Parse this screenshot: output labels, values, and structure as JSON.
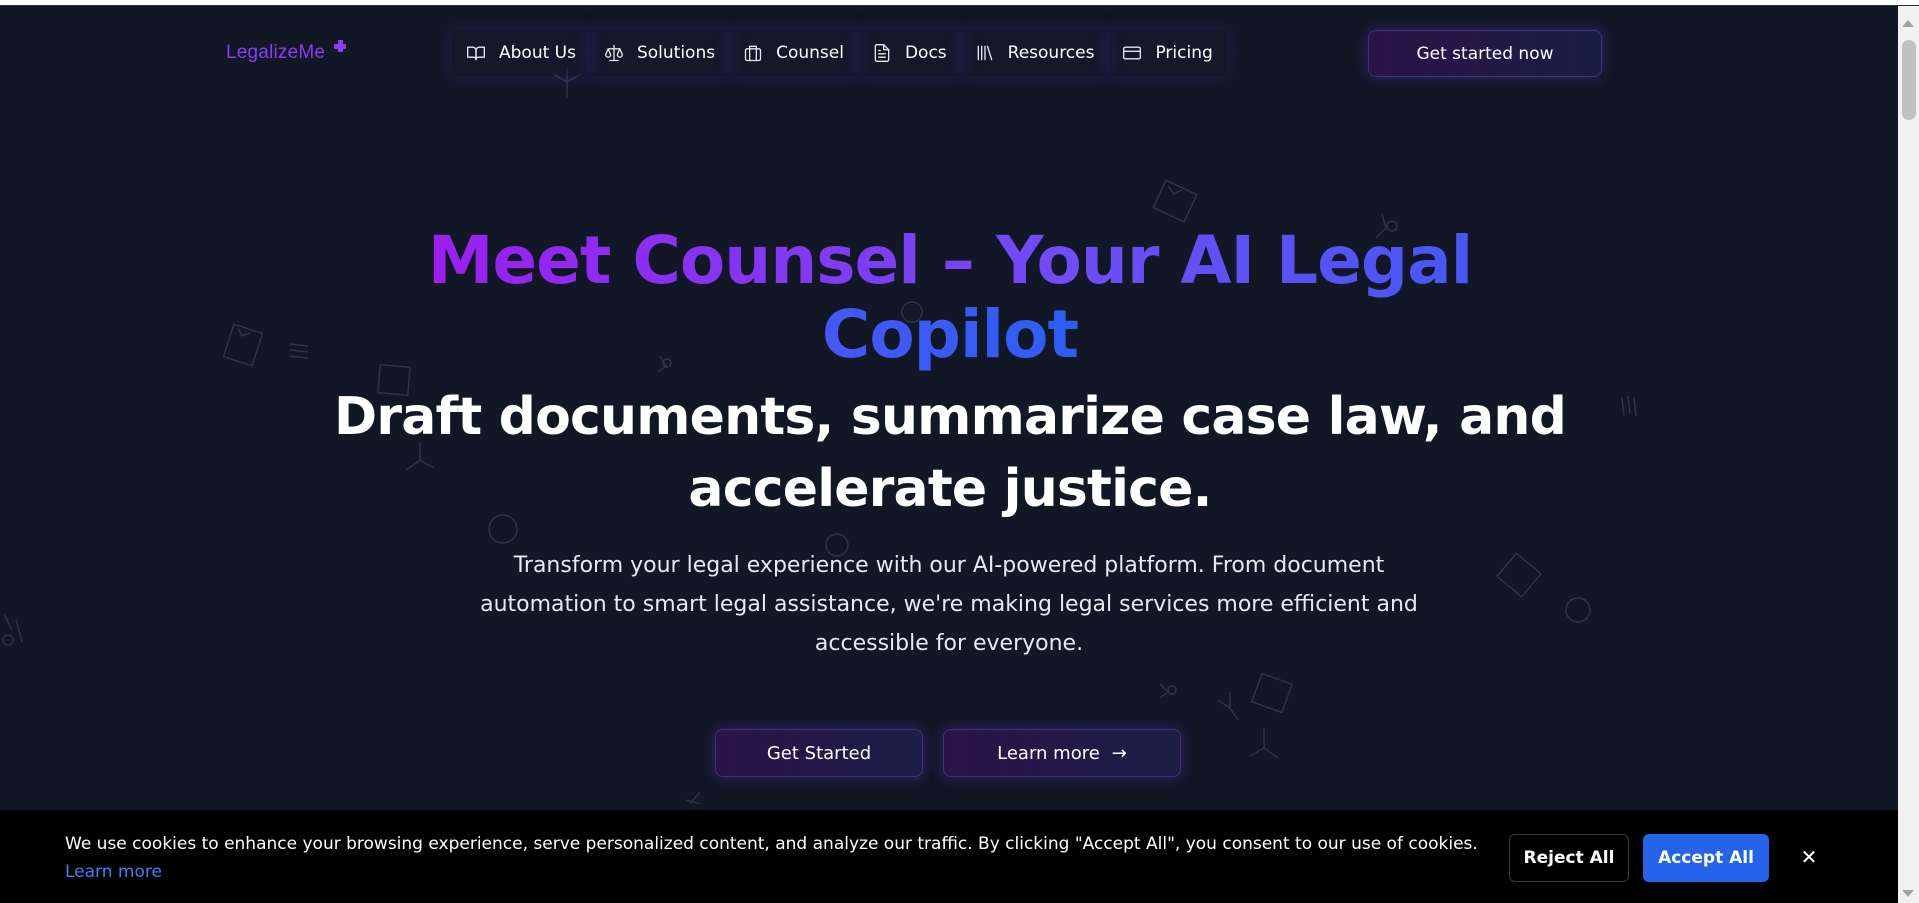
{
  "brand": {
    "name": "LegalizeMe",
    "accent": "#8b3cf7"
  },
  "nav": {
    "items": [
      {
        "label": "About Us",
        "icon": "book-open-icon"
      },
      {
        "label": "Solutions",
        "icon": "scale-icon"
      },
      {
        "label": "Counsel",
        "icon": "briefcase-icon"
      },
      {
        "label": "Docs",
        "icon": "document-icon"
      },
      {
        "label": "Resources",
        "icon": "library-icon"
      },
      {
        "label": "Pricing",
        "icon": "credit-card-icon"
      }
    ],
    "cta_label": "Get started now"
  },
  "hero": {
    "title": "Meet Counsel – Your AI Legal Copilot",
    "subtitle": "Draft documents, summarize case law, and accelerate justice.",
    "description": "Transform your legal experience with our AI-powered platform. From document automation to smart legal assistance, we're making legal services more efficient and accessible for everyone.",
    "primary_button": "Get Started",
    "secondary_button": "Learn more",
    "secondary_button_icon": "arrow-right-icon",
    "gradient": [
      "#9b1ff0",
      "#6f4cf6",
      "#2b5ff6"
    ]
  },
  "cookie_banner": {
    "text": "We use cookies to enhance your browsing experience, serve personalized content, and analyze our traffic. By clicking \"Accept All\", you consent to our use of cookies. ",
    "link_label": "Learn more",
    "reject_label": "Reject All",
    "accept_label": "Accept All",
    "close_icon": "close-icon",
    "accept_color": "#2563eb"
  },
  "theme": {
    "background": "#121726"
  }
}
